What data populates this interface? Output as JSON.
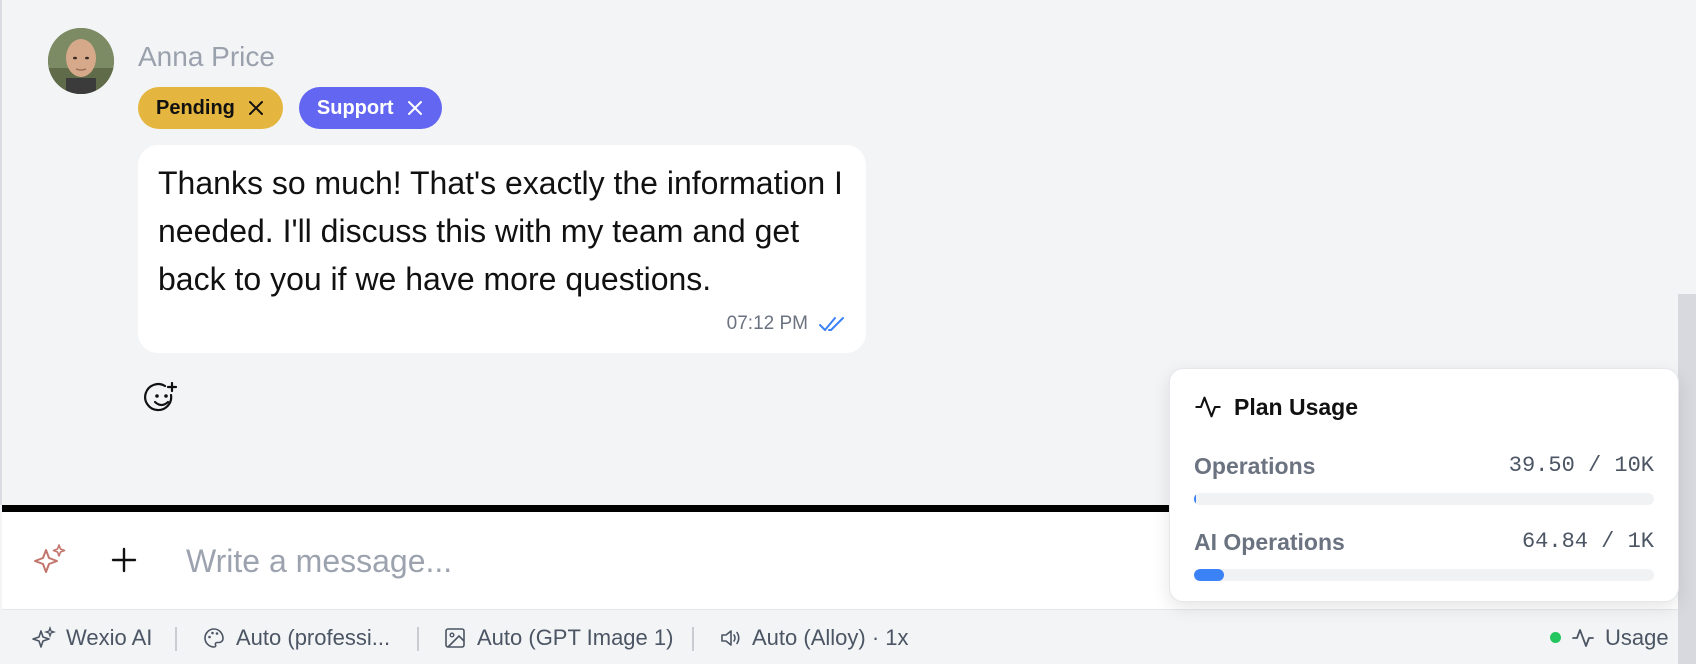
{
  "message": {
    "sender": "Anna Price",
    "tags": [
      {
        "label": "Pending",
        "color": "#e4b63f"
      },
      {
        "label": "Support",
        "color": "#6366f1"
      }
    ],
    "text": "Thanks so much! That's exactly the information I needed. I'll discuss this with my team and get back to you if we have more questions.",
    "time": "07:12 PM",
    "status_icon": "double-check-icon"
  },
  "composer": {
    "placeholder": "Write a message...",
    "ai_icon": "sparkles-icon",
    "add_icon": "plus-icon"
  },
  "bottombar": {
    "assistant": "Wexio AI",
    "tone": "Auto (professi...",
    "image_model": "Auto (GPT Image 1)",
    "voice": "Auto (Alloy) · 1x",
    "usage": "Usage"
  },
  "plan_usage": {
    "title": "Plan Usage",
    "operations": {
      "label": "Operations",
      "value": "39.50 / 10K",
      "fraction": 0.00395
    },
    "ai_operations": {
      "label": "AI Operations",
      "value": "64.84 / 1K",
      "fraction": 0.06484
    }
  },
  "colors": {
    "accent": "#3b82f6",
    "status_online": "#22c55e"
  }
}
